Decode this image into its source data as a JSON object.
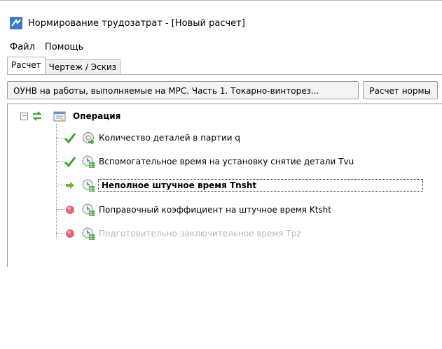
{
  "window": {
    "title": "Нормирование трудозатрат - [Новый расчет]"
  },
  "menu": {
    "items": [
      "Файл",
      "Помощь"
    ]
  },
  "tabs": [
    {
      "label": "Расчет",
      "active": true
    },
    {
      "label": "Чертеж / Эскиз",
      "active": false
    }
  ],
  "crumbs": [
    {
      "label": "ОУНВ на работы, выполняемые на МРС. Часть 1. Токарно-винторез..."
    },
    {
      "label": "Расчет нормы"
    }
  ],
  "tree": {
    "root": {
      "label": "Операция",
      "icons": [
        "refresh-arrows-icon",
        "form-icon"
      ]
    },
    "children": [
      {
        "label": "Количество деталей в партии q",
        "status": "check",
        "item_icon": "gear-arrow-icon"
      },
      {
        "label": "Вспомогательное время на установку снятие детали Tvu",
        "status": "check",
        "item_icon": "clock-table-icon"
      },
      {
        "label": "Неполное штучное время Tnsht",
        "status": "current",
        "item_icon": "clock-table-icon"
      },
      {
        "label": "Поправочный коэффициент на штучное время Ktsht",
        "status": "pending",
        "item_icon": "clock-table-icon"
      },
      {
        "label": "Подготовительно-заключительное время Tpz",
        "status": "pending",
        "item_icon": "clock-table-icon"
      }
    ]
  },
  "colors": {
    "check": "#3aa535",
    "current": "#3aa535",
    "pending": "#e06a70",
    "disabled_text": "#b8b8b8"
  }
}
